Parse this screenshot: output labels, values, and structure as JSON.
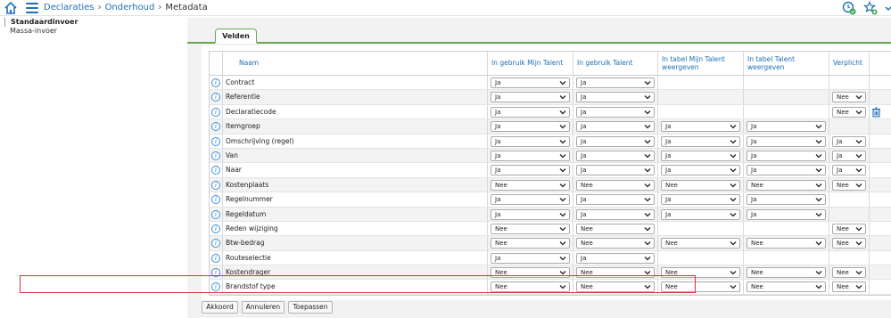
{
  "topbar": {
    "breadcrumbs": [
      {
        "label": "Declaraties",
        "link": true
      },
      {
        "label": "Onderhoud",
        "link": true
      },
      {
        "label": "Metadata",
        "link": false
      }
    ],
    "icons": [
      "home-icon",
      "menu-icon",
      "clock-check-icon",
      "star-add-icon",
      "chevron-down-icon"
    ]
  },
  "leftnav": {
    "items": [
      "Standaardinvoer",
      "Massa-invoer"
    ]
  },
  "tabs": [
    "Velden"
  ],
  "grid": {
    "headers": {
      "naam": "Naam",
      "col1": "In gebruik Mijn Talent",
      "col2": "In gebruik Talent",
      "col3": "In tabel Mijn Talent weergeven",
      "col4": "In tabel Talent weergeven",
      "col5": "Verplicht"
    },
    "rows": [
      {
        "name": "Contract",
        "c1": "Ja",
        "c2": "Ja",
        "c3": "",
        "c4": "",
        "c5": "",
        "trash": false
      },
      {
        "name": "Referentie",
        "c1": "Ja",
        "c2": "Ja",
        "c3": "",
        "c4": "",
        "c5": "Nee",
        "trash": false
      },
      {
        "name": "Declaratiecode",
        "c1": "Ja",
        "c2": "Ja",
        "c3": "",
        "c4": "",
        "c5": "Nee",
        "trash": true
      },
      {
        "name": "Itemgroep",
        "c1": "Ja",
        "c2": "Ja",
        "c3": "Ja",
        "c4": "Ja",
        "c5": "",
        "trash": false
      },
      {
        "name": "Omschrijving (regel)",
        "c1": "Ja",
        "c2": "Ja",
        "c3": "Ja",
        "c4": "Ja",
        "c5": "Ja",
        "trash": false
      },
      {
        "name": "Van",
        "c1": "Ja",
        "c2": "Ja",
        "c3": "Ja",
        "c4": "Ja",
        "c5": "Ja",
        "trash": false
      },
      {
        "name": "Naar",
        "c1": "Ja",
        "c2": "Ja",
        "c3": "Ja",
        "c4": "Ja",
        "c5": "Ja",
        "trash": false
      },
      {
        "name": "Kostenplaats",
        "c1": "Nee",
        "c2": "Nee",
        "c3": "Nee",
        "c4": "Nee",
        "c5": "Nee",
        "trash": false
      },
      {
        "name": "Regelnummer",
        "c1": "Ja",
        "c2": "Ja",
        "c3": "Ja",
        "c4": "Ja",
        "c5": "",
        "trash": false
      },
      {
        "name": "Regeldatum",
        "c1": "Ja",
        "c2": "Ja",
        "c3": "Ja",
        "c4": "Ja",
        "c5": "",
        "trash": false
      },
      {
        "name": "Reden wijziging",
        "c1": "Nee",
        "c2": "Nee",
        "c3": "",
        "c4": "",
        "c5": "Nee",
        "trash": false
      },
      {
        "name": "Btw-bedrag",
        "c1": "Nee",
        "c2": "Nee",
        "c3": "Nee",
        "c4": "Nee",
        "c5": "Nee",
        "trash": false
      },
      {
        "name": "Routeselectie",
        "c1": "Ja",
        "c2": "Ja",
        "c3": "",
        "c4": "",
        "c5": "",
        "trash": false
      },
      {
        "name": "Kostendrager",
        "c1": "Nee",
        "c2": "Nee",
        "c3": "Nee",
        "c4": "Nee",
        "c5": "Nee",
        "trash": false
      },
      {
        "name": "Brandstof type",
        "c1": "Nee",
        "c2": "Nee",
        "c3": "Nee",
        "c4": "Nee",
        "c5": "Nee",
        "trash": false
      }
    ]
  },
  "buttons": [
    "Akkoord",
    "Annuleren",
    "Toepassen"
  ],
  "colors": {
    "accent_blue": "#1f6fb5",
    "tab_green": "#6aa84f",
    "highlight_red": "#e0312e"
  }
}
